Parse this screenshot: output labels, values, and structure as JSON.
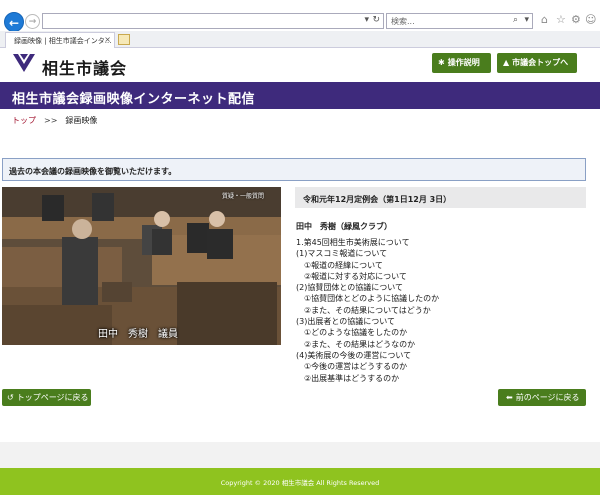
{
  "browser": {
    "address_value": "",
    "search_placeholder": "検索...",
    "tab_title": "録画映像 | 相生市議会インタ...",
    "tab_close": "×"
  },
  "site": {
    "name": "相生市議会",
    "help_label": "操作説明",
    "top_label": "市議会トップへ"
  },
  "banner": {
    "title": "相生市議会録画映像インターネット配信"
  },
  "breadcrumb": {
    "home": "トップ",
    "sep": ">>",
    "current": "録画映像"
  },
  "notice": "過去の本会議の録画映像を御覧いただけます。",
  "video": {
    "caption": "田中　秀樹　議員",
    "tag": "質疑・一般質問"
  },
  "session": {
    "title": "令和元年12月定例会（第1日12月 3日）",
    "speaker": "田中　秀樹（緑風クラブ）",
    "topics": [
      "1.第45回相生市美術展について",
      "(1)マスコミ報道について",
      "　①報道の経緯について",
      "　②報道に対する対応について",
      "(2)協賛団体との協議について",
      "　①協賛団体とどのように協議したのか",
      "　②また、その結果についてはどうか",
      "(3)出展者との協議について",
      "　①どのような協議をしたのか",
      "　②また、その結果はどうなのか",
      "(4)美術展の今後の運営について",
      "　①今後の運営はどうするのか",
      "　②出展基準はどうするのか"
    ]
  },
  "buttons": {
    "toppage": "トップページに戻る",
    "prev": "前のページに戻る"
  },
  "footer": "Copyright © 2020 相生市議会 All Rights Reserved",
  "colors": {
    "banner": "#3e2a7c",
    "button": "#4a7d1d",
    "footer": "#8fc31f",
    "link": "#a0102c"
  }
}
